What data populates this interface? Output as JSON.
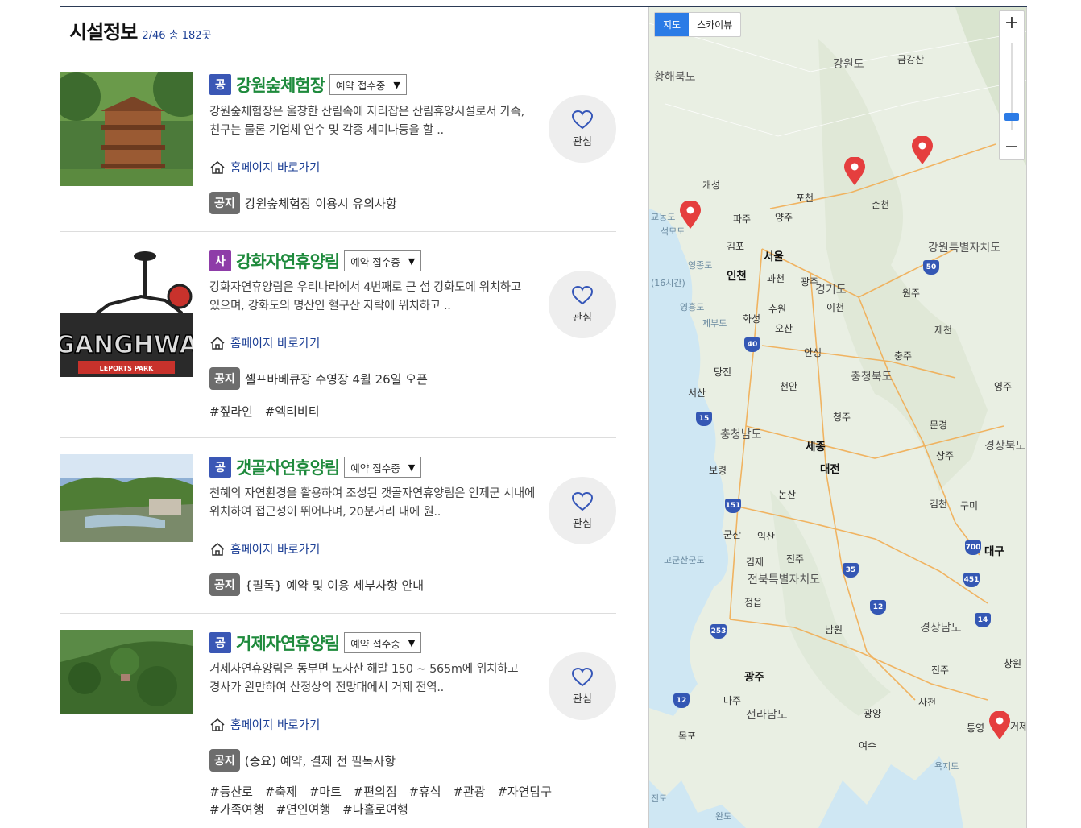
{
  "header": {
    "title": "시설정보",
    "count": "2/46 총 182곳"
  },
  "items": [
    {
      "badge": "공",
      "badge_type": "gong",
      "title": "강원숲체험장",
      "status": "예약 접수중",
      "desc": "강원숲체험장은 울창한 산림속에 자리잡은 산림휴양시설로서 가족, 친구는 물론 기업체 연수 및 각종 세미나등을 할 ..",
      "homepage": "홈페이지 바로가기",
      "notice_badge": "공지",
      "notice": "강원숲체험장 이용시 유의사항",
      "fav": "관심"
    },
    {
      "badge": "사",
      "badge_type": "sa",
      "title": "강화자연휴양림",
      "status": "예약 접수중",
      "desc": "강화자연휴양림은 우리나라에서 4번째로 큰 섬 강화도에 위치하고 있으며, 강화도의 명산인 혈구산 자락에 위치하고 ..",
      "homepage": "홈페이지 바로가기",
      "notice_badge": "공지",
      "notice": "셀프바베큐장 수영장 4월 26일 오픈",
      "tags": [
        "#짚라인",
        "#엑티비티"
      ],
      "logo_text": "GANGHWA",
      "logo_sub": "LEPORTS PARK",
      "fav": "관심"
    },
    {
      "badge": "공",
      "badge_type": "gong",
      "title": "갯골자연휴양림",
      "status": "예약 접수중",
      "desc": "천혜의 자연환경을 활용하여 조성된 갯골자연휴양림은 인제군 시내에 위치하여 접근성이 뛰어나며, 20분거리 내에 원..",
      "homepage": "홈페이지 바로가기",
      "notice_badge": "공지",
      "notice": "{필독} 예약 및 이용 세부사항 안내",
      "fav": "관심"
    },
    {
      "badge": "공",
      "badge_type": "gong",
      "title": "거제자연휴양림",
      "status": "예약 접수중",
      "desc": "거제자연휴양림은 동부면 노자산 해발 150 ~ 565m에 위치하고 경사가 완만하여 산정상의 전망대에서 거제 전역..",
      "homepage": "홈페이지 바로가기",
      "notice_badge": "공지",
      "notice": "(중요) 예약, 결제 전 필독사항",
      "tags": [
        "#등산로",
        "#축제",
        "#마트",
        "#편의점",
        "#휴식",
        "#관광",
        "#자연탐구",
        "#가족여행",
        "#연인여행",
        "#나홀로여행"
      ],
      "fav": "관심"
    }
  ],
  "map": {
    "toggle": [
      "지도",
      "스카이뷰"
    ],
    "zoom_in": "+",
    "zoom_out": "−",
    "labels": {
      "hwanghae": "황해북도",
      "gangwon_n": "강원도",
      "geumgang": "금강산",
      "gaeseong": "개성",
      "pocheon": "포천",
      "chuncheon": "춘천",
      "paju": "파주",
      "yangju": "양주",
      "gyodong": "교동도",
      "seongmo": "석모도",
      "gimpo": "김포",
      "seoul": "서울",
      "gangwon": "강원특별자치도",
      "yeongjong": "영종도",
      "incheon": "인천",
      "gwacheon": "과천",
      "gwangju_g": "광주",
      "gyeonggi": "경기도",
      "wonju": "원주",
      "yeongheung": "영흥도",
      "suwon": "수원",
      "icheon": "이천",
      "jebu": "제부도",
      "hwaseong": "화성",
      "osan": "오산",
      "jecheon": "제천",
      "anseong": "안성",
      "chungju": "충주",
      "dangjin": "당진",
      "chungbuk": "충청북도",
      "seosan": "서산",
      "cheonan": "천안",
      "yeongju": "영주",
      "cheongju": "청주",
      "mungyeong": "문경",
      "chungnam": "충청남도",
      "sejong": "세종",
      "gyeongbuk": "경상북도",
      "boryeong": "보령",
      "daejeon": "대전",
      "sangju": "상주",
      "nonsan": "논산",
      "gimcheon": "김천",
      "gumi": "구미",
      "gunsan": "군산",
      "iksan": "익산",
      "gogunsan": "고군산군도",
      "gimje": "김제",
      "jeonju": "전주",
      "daegu": "대구",
      "jeonbuk": "전북특별자치도",
      "jeongeup": "정읍",
      "gyeongnam": "경상남도",
      "namwon": "남원",
      "gwangju": "광주",
      "jinju": "진주",
      "changwon": "창원",
      "naju": "나주",
      "jeonnam": "전라남도",
      "sacheon": "사천",
      "gwangyang": "광양",
      "mokpo": "목포",
      "tongyeong": "통영",
      "geoje": "거제",
      "yeosu": "여수",
      "yokji": "욕지도",
      "jindo": "진도",
      "wando": "완도",
      "hansan": "(16시간)"
    },
    "highways": [
      "50",
      "40",
      "15",
      "151",
      "700",
      "451",
      "35",
      "12",
      "253",
      "14",
      "12"
    ]
  }
}
